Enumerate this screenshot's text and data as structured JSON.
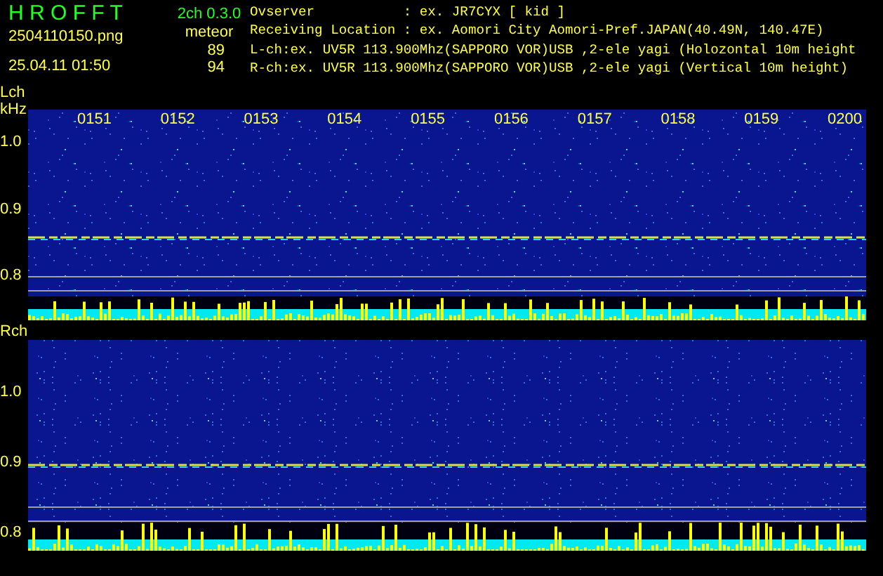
{
  "app": {
    "name": "H R O F F T",
    "version": "2ch 0.3.0",
    "file": "2504110150.png",
    "timestamp": "25.04.11 01:50",
    "mode": "meteor",
    "counts": [
      "89",
      "94"
    ]
  },
  "info_lines": [
    "Ovserver           : ex. JR7CYX [ kid ]",
    "Receiving Location : ex. Aomori City Aomori-Pref.JAPAN(40.49N, 140.47E)",
    "L-ch:ex. UV5R 113.900Mhz(SAPPORO VOR)USB ,2-ele yagi (Holozontal 10m height",
    "R-ch:ex. UV5R 113.900Mhz(SAPPORO VOR)USB ,2-ele yagi (Vertical 10m height)"
  ],
  "panels": [
    {
      "label": "Lch",
      "unit": "kHz",
      "time_labels": [
        "0151",
        "0152",
        "0153",
        "0154",
        "0155",
        "0156",
        "0157",
        "0158",
        "0159",
        "0200"
      ],
      "freq_labels": [
        "1.0",
        "0.9",
        "0.8"
      ]
    },
    {
      "label": "Rch",
      "freq_labels": [
        "1.0",
        "0.9",
        "0.8"
      ]
    }
  ]
}
